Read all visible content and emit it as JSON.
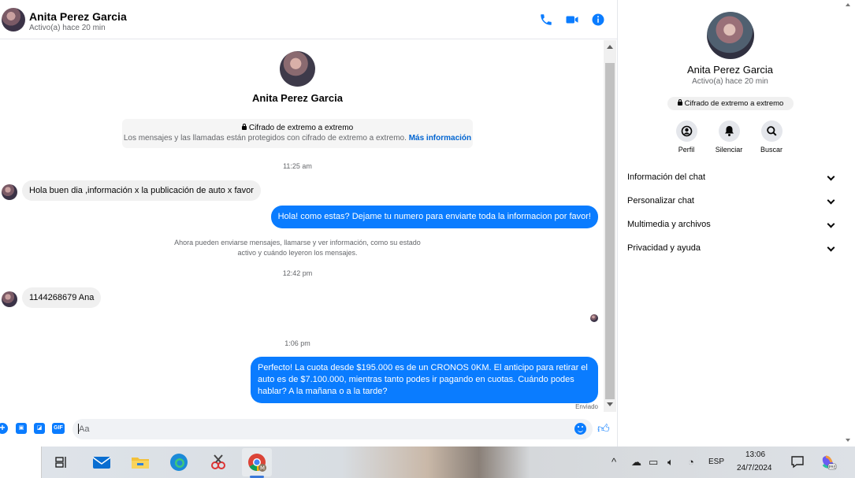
{
  "header": {
    "name": "Anita Perez Garcia",
    "status": "Activo(a) hace 20 min"
  },
  "intro": {
    "name": "Anita Perez Garcia",
    "e2e_title": "Cifrado de extremo a extremo",
    "e2e_sub": "Los mensajes y las llamadas están protegidos con cifrado de extremo a extremo.",
    "e2e_link": "Más información"
  },
  "messages": {
    "ts1": "11:25 am",
    "in1": "Hola buen dia ,información x la publicación de auto x favor",
    "out1": "Hola! como estas? Dejame tu numero para enviarte toda la informacion por favor!",
    "note_line1": "Ahora pueden enviarse mensajes, llamarse y ver información, como su estado",
    "note_line2": "activo y cuándo leyeron los mensajes.",
    "ts2": "12:42 pm",
    "in2": "1144268679 Ana",
    "ts3": "1:06 pm",
    "out2_line1": "Perfecto! La cuota desde $195.000 es de un CRONOS 0KM. El anticipo para retirar el",
    "out2_line2": "auto es de $7.100.000, mientras tanto podes ir pagando en cuotas. Cuándo podes",
    "out2_line3": "hablar? A la mañana o a la tarde?",
    "sent": "Enviado"
  },
  "composer": {
    "placeholder": "Aa",
    "gif": "GIF"
  },
  "side": {
    "name": "Anita Perez Garcia",
    "status": "Activo(a) hace 20 min",
    "e2e": "Cifrado de extremo a extremo",
    "actions": [
      "Perfil",
      "Silenciar",
      "Buscar"
    ],
    "sections": [
      "Información del chat",
      "Personalizar chat",
      "Multimedia y archivos",
      "Privacidad y ayuda"
    ]
  },
  "taskbar": {
    "lang": "ESP",
    "time": "13:06",
    "date": "24/7/2024"
  },
  "colors": {
    "accent": "#0a7cff",
    "bubble_in": "#f0f0f0",
    "muted_text": "#65676b"
  }
}
